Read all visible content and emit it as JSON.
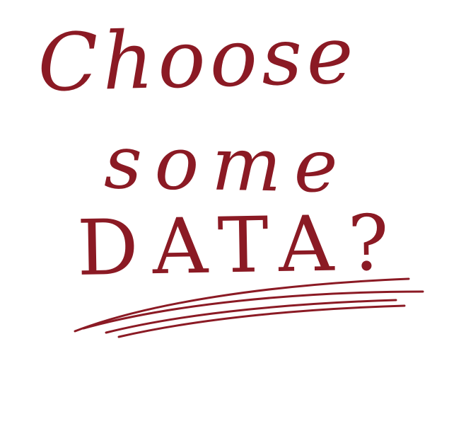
{
  "handwriting": {
    "line1": "Choose",
    "line2": "some",
    "line3": "DATA?"
  },
  "colors": {
    "ink": "#8b1a24",
    "background": "#ffffff"
  }
}
